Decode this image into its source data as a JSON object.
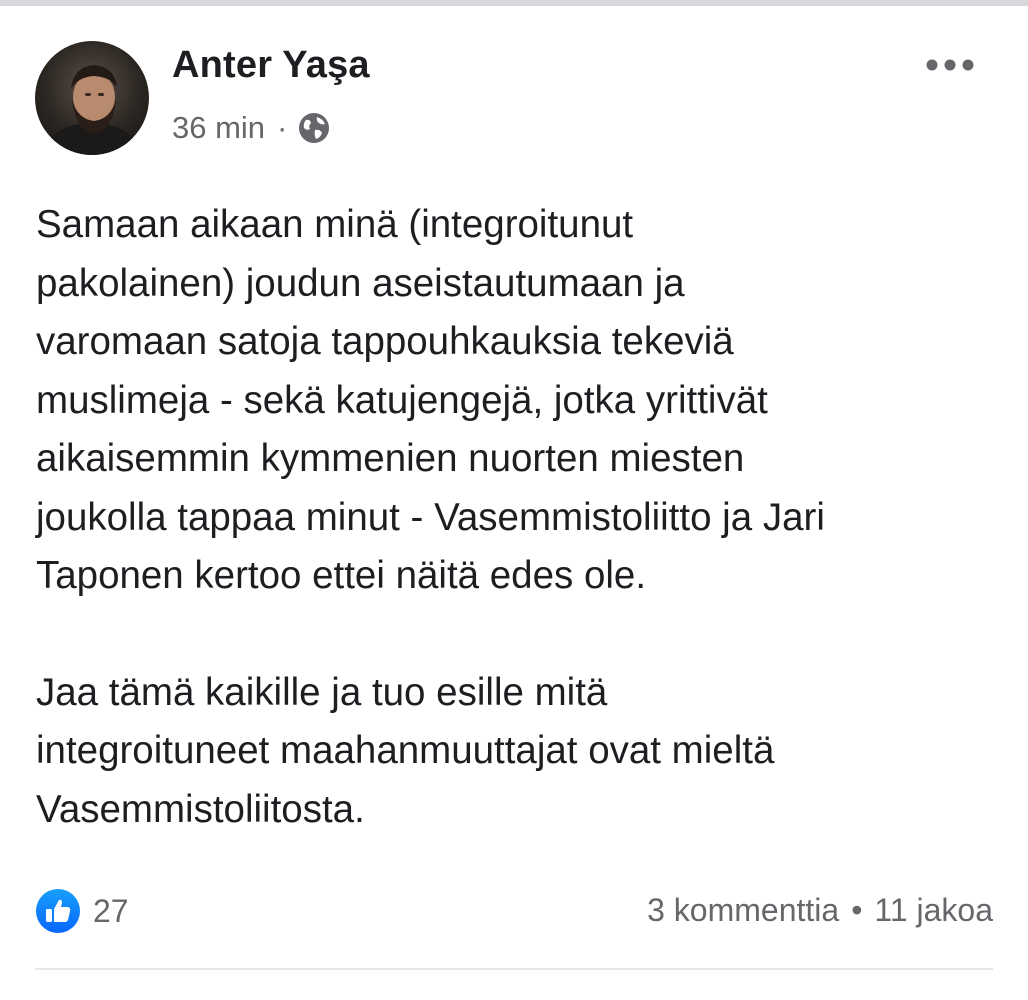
{
  "post": {
    "author": "Anter Yaşa",
    "time": "36 min",
    "meta_separator": "·",
    "privacy_icon": "globe-icon",
    "more_icon": "more-options-icon",
    "paragraphs": [
      [
        "Samaan aikaan minä (integroitunut",
        "pakolainen) joudun aseistautumaan ja",
        "varomaan satoja tappouhkauksia tekeviä",
        "muslimeja - sekä katujengejä, jotka yrittivät",
        "aikaisemmin kymmenien nuorten miesten",
        "joukolla tappaa minut - Vasemmistoliitto ja Jari",
        "Taponen kertoo ettei näitä edes ole."
      ],
      [
        "Jaa tämä kaikille ja tuo esille mitä",
        "integroituneet maahanmuuttajat ovat mieltä",
        "Vasemmistoliitosta."
      ]
    ],
    "reaction_icon": "like-icon",
    "reaction_count": "27",
    "comments": "3 kommenttia",
    "stats_separator": "•",
    "shares": "11 jakoa"
  },
  "colors": {
    "accent": "#1877f2",
    "secondary_text": "#65676b",
    "primary_text": "#1c1e21"
  }
}
